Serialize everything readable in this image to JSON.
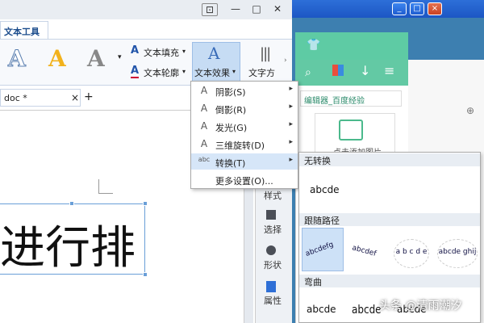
{
  "background_window": {
    "xp_buttons": [
      "_",
      "□",
      "×"
    ],
    "green_tab_title": "编辑器_百度经验",
    "image_prompt": "点击添加图片"
  },
  "title_bar": {
    "icon_button": "⊡",
    "minimize": "—",
    "maximize": "□",
    "close": "✕"
  },
  "ribbon": {
    "tab_label": "文本工具",
    "style_samples": [
      "A",
      "A",
      "A"
    ],
    "fill_label": "文本填充",
    "outline_label": "文本轮廓",
    "effect_label": "文本效果",
    "direction_label": "文字方"
  },
  "document": {
    "tab_label": "doc *",
    "close": "×",
    "new_tab": "+",
    "body_text": "进行排"
  },
  "side_panel": {
    "items": [
      "样式",
      "选择",
      "形状",
      "属性"
    ]
  },
  "effect_menu": {
    "items": [
      {
        "icon": "A",
        "label": "阴影(S)",
        "has_submenu": true
      },
      {
        "icon": "A",
        "label": "倒影(R)",
        "has_submenu": true
      },
      {
        "icon": "A",
        "label": "发光(G)",
        "has_submenu": true
      },
      {
        "icon": "A",
        "label": "三维旋转(D)",
        "has_submenu": true
      },
      {
        "icon": "abc",
        "label": "转换(T)",
        "has_submenu": true
      },
      {
        "icon": "",
        "label": "更多设置(O)...",
        "has_submenu": false
      }
    ]
  },
  "transform_menu": {
    "section_none": "无转换",
    "sample_none": "abcde",
    "section_path": "跟随路径",
    "path_samples": [
      "abcdefg",
      "abcdef",
      "a b c d e",
      "abcde ghij"
    ],
    "section_warp": "弯曲",
    "warp_samples": [
      "abcde",
      "abcde",
      "abcde"
    ]
  },
  "watermark": "头条 @清雨潮汐"
}
